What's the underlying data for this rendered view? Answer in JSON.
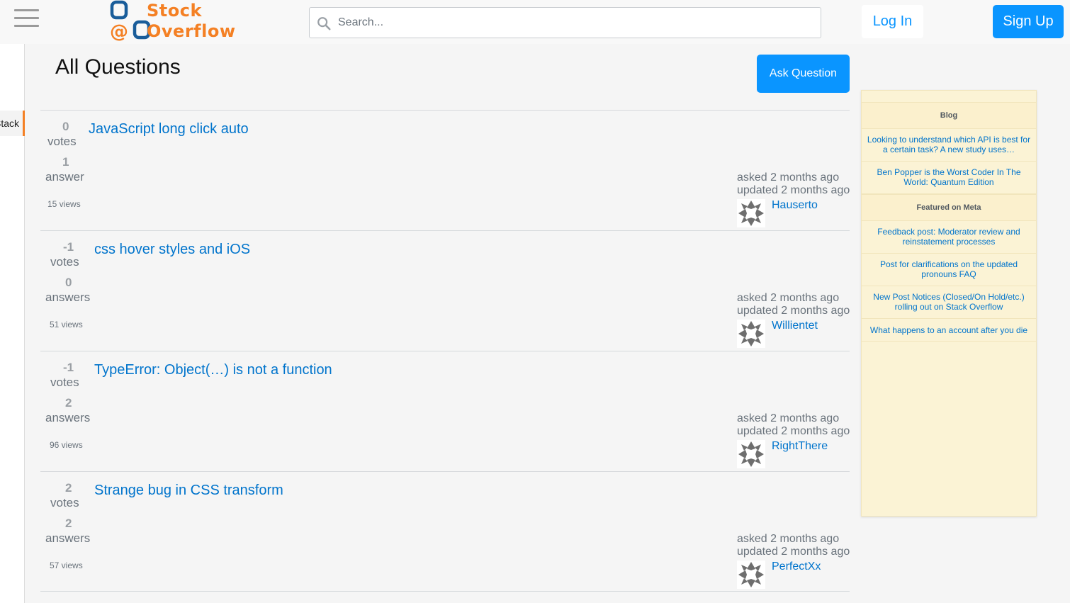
{
  "header": {
    "logo": {
      "line1": "Stock",
      "line2": "Overflow"
    },
    "search_placeholder": "Search...",
    "login_label": "Log In",
    "signup_label": "Sign Up"
  },
  "sidebar": {
    "active_item": "Stack Overflow"
  },
  "main": {
    "title": "All Questions",
    "ask_label": "Ask Question",
    "questions": [
      {
        "votes": "0",
        "votes_label": "votes",
        "answers": "1",
        "answers_label": "answer",
        "views": "15 views",
        "title": "JavaScript long click auto",
        "asked": "asked 2 months ago",
        "updated": "updated 2 months ago",
        "user": "Hauserto"
      },
      {
        "votes": "-1",
        "votes_label": "votes",
        "answers": "0",
        "answers_label": "answers",
        "views": "51 views",
        "title": "css hover styles and iOS",
        "asked": "asked 2 months ago",
        "updated": "updated 2 months ago",
        "user": "Willientet"
      },
      {
        "votes": "-1",
        "votes_label": "votes",
        "answers": "2",
        "answers_label": "answers",
        "views": "96 views",
        "title": "TypeError: Object(…) is not a function",
        "asked": "asked 2 months ago",
        "updated": "updated 2 months ago",
        "user": "RightThere"
      },
      {
        "votes": "2",
        "votes_label": "votes",
        "answers": "2",
        "answers_label": "answers",
        "views": "57 views",
        "title": "Strange bug in CSS transform",
        "asked": "asked 2 months ago",
        "updated": "updated 2 months ago",
        "user": "PerfectXx"
      }
    ]
  },
  "widget": {
    "blog_header": "Blog",
    "blog_items": [
      "Looking to understand which API is best for a certain task? A new study uses…",
      "Ben Popper is the Worst Coder In The World: Quantum Edition"
    ],
    "meta_header": "Featured on Meta",
    "meta_items": [
      "Feedback post: Moderator review and reinstatement processes",
      "Post for clarifications on the updated pronouns FAQ",
      "New Post Notices (Closed/On Hold/etc.) rolling out on Stack Overflow",
      "What happens to an account after you die"
    ]
  },
  "colors": {
    "accent": "#0a95ff",
    "brand_orange": "#f48024",
    "link": "#0074cc",
    "widget_bg": "#fbf3d5"
  },
  "icons": [
    "menu-icon",
    "search-icon",
    "avatar-icon"
  ]
}
